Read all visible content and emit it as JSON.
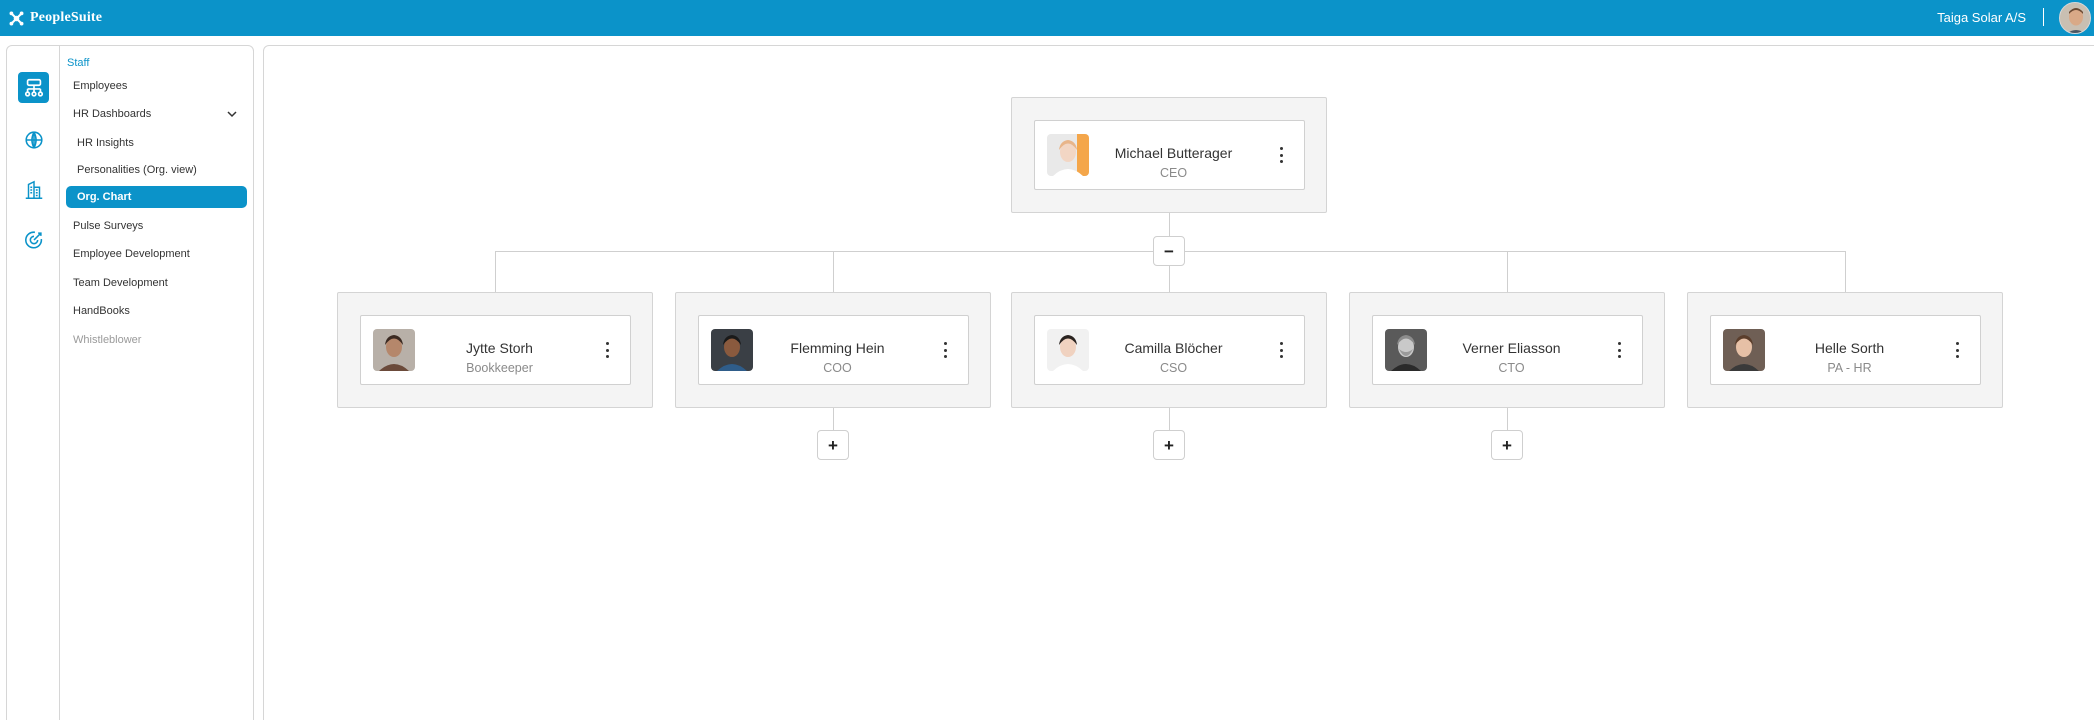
{
  "app": {
    "brand": "PeopleSuite",
    "company": "Taiga Solar A/S"
  },
  "rail": [
    {
      "icon": "org-chart-icon",
      "active": true
    },
    {
      "icon": "globe-icon",
      "active": false
    },
    {
      "icon": "building-icon",
      "active": false
    },
    {
      "icon": "target-icon",
      "active": false
    }
  ],
  "nav": {
    "header": "Staff",
    "items": [
      {
        "label": "Employees",
        "sub": false,
        "active": false,
        "muted": false
      },
      {
        "label": "HR Dashboards",
        "sub": false,
        "active": false,
        "muted": false,
        "expanded": true
      },
      {
        "label": "HR Insights",
        "sub": true,
        "active": false,
        "muted": false
      },
      {
        "label": "Personalities (Org. view)",
        "sub": true,
        "active": false,
        "muted": false
      },
      {
        "label": "Org. Chart",
        "sub": true,
        "active": true,
        "muted": false
      },
      {
        "label": "Pulse Surveys",
        "sub": false,
        "active": false,
        "muted": false
      },
      {
        "label": "Employee Development",
        "sub": false,
        "active": false,
        "muted": false
      },
      {
        "label": "Team Development",
        "sub": false,
        "active": false,
        "muted": false
      },
      {
        "label": "HandBooks",
        "sub": false,
        "active": false,
        "muted": false
      },
      {
        "label": "Whistleblower",
        "sub": false,
        "active": false,
        "muted": true
      }
    ]
  },
  "org": {
    "root": {
      "name": "Michael Butterager",
      "title": "CEO",
      "collapse_symbol": "−"
    },
    "reports": [
      {
        "name": "Jytte Storh",
        "title": "Bookkeeper",
        "has_children": false
      },
      {
        "name": "Flemming Hein",
        "title": "COO",
        "has_children": true
      },
      {
        "name": "Camilla Blöcher",
        "title": "CSO",
        "has_children": true
      },
      {
        "name": "Verner Eliasson",
        "title": "CTO",
        "has_children": true
      },
      {
        "name": "Helle Sorth",
        "title": "PA - HR",
        "has_children": false
      }
    ],
    "expand_symbol": "+"
  },
  "colors": {
    "accent": "#0b93c9",
    "connector": "#cfcfcf",
    "node_bg": "#f4f4f4"
  }
}
